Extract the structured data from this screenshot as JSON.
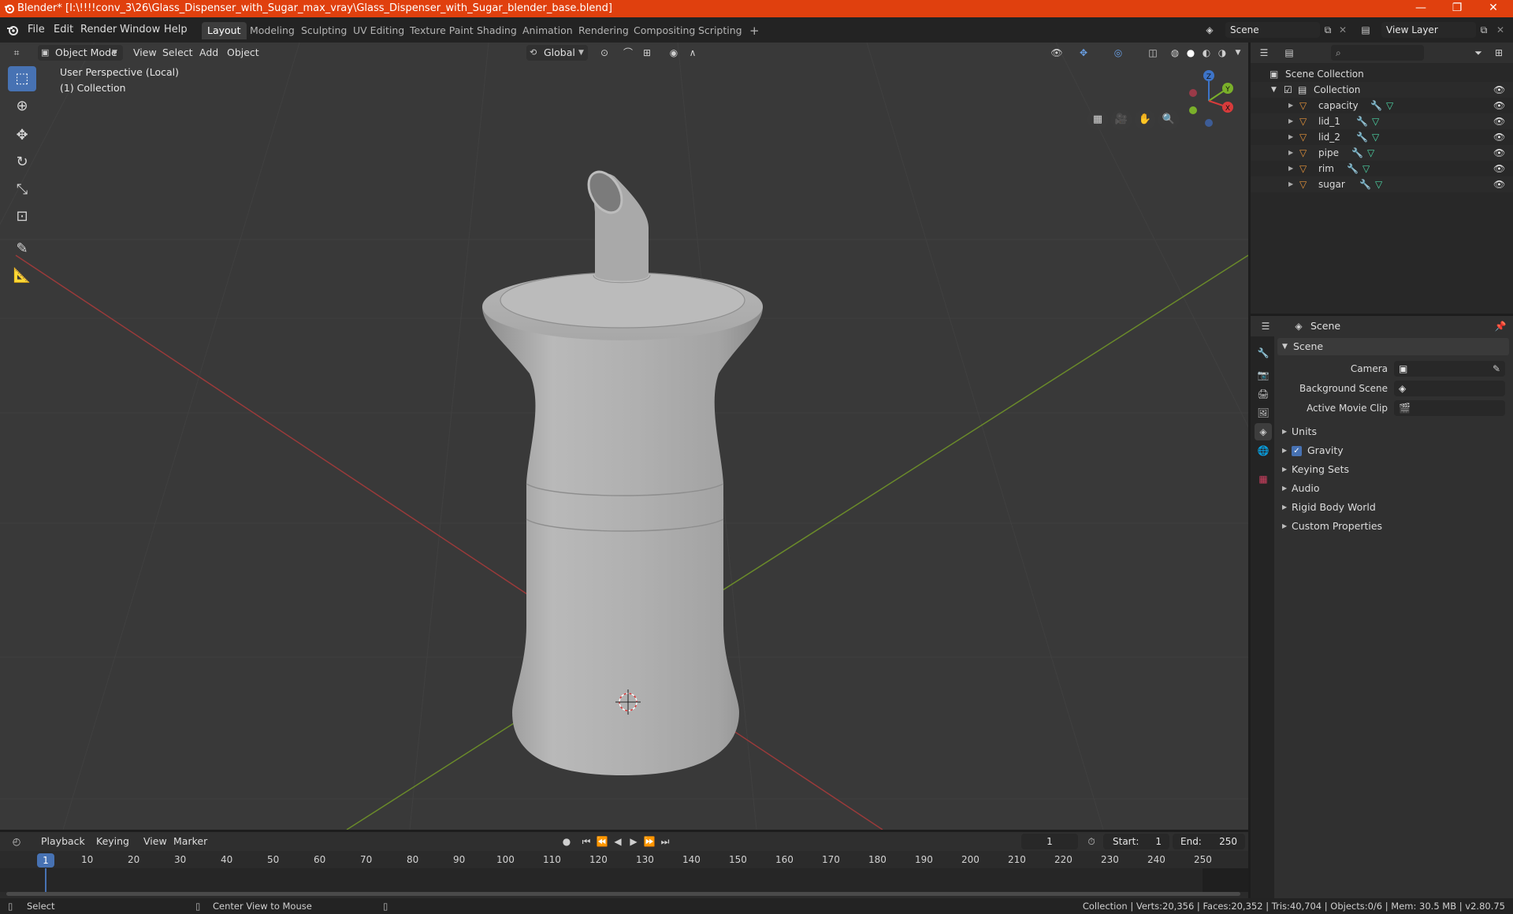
{
  "window": {
    "title": "Blender* [I:\\!!!!conv_3\\26\\Glass_Dispenser_with_Sugar_max_vray\\Glass_Dispenser_with_Sugar_blender_base.blend]",
    "minimize": "—",
    "restore": "❐",
    "close": "✕",
    "accent": "#e0400e"
  },
  "menu": {
    "items": [
      "File",
      "Edit",
      "Render",
      "Window",
      "Help"
    ]
  },
  "workspaces": {
    "tabs": [
      "Layout",
      "Modeling",
      "Sculpting",
      "UV Editing",
      "Texture Paint",
      "Shading",
      "Animation",
      "Rendering",
      "Compositing",
      "Scripting"
    ],
    "active": "Layout",
    "add": "+"
  },
  "scene_selector": {
    "value": "Scene"
  },
  "view_layer_selector": {
    "value": "View Layer"
  },
  "viewport": {
    "mode": "Object Mode",
    "menus": [
      "View",
      "Select",
      "Add",
      "Object"
    ],
    "orientation": "Global",
    "perspective_label": "User Perspective (Local)",
    "collection_label": "(1) Collection",
    "background": "#393939",
    "gizmo": {
      "z": "Z",
      "y": "Y",
      "x": "X"
    }
  },
  "outliner": {
    "root": "Scene Collection",
    "collection": "Collection",
    "objects": [
      "capacity",
      "lid_1",
      "lid_2",
      "pipe",
      "rim",
      "sugar"
    ]
  },
  "properties": {
    "context": "Scene",
    "panel_title": "Scene",
    "fields": {
      "camera": "Camera",
      "background_scene": "Background Scene",
      "active_movie_clip": "Active Movie Clip"
    },
    "panels": [
      "Units",
      "Gravity",
      "Keying Sets",
      "Audio",
      "Rigid Body World",
      "Custom Properties"
    ],
    "gravity_checked": true
  },
  "timeline": {
    "menus": [
      "Playback",
      "Keying",
      "View",
      "Marker"
    ],
    "current_frame": "1",
    "start_label": "Start:",
    "start_value": "1",
    "end_label": "End:",
    "end_value": "250",
    "ticks": [
      "10",
      "20",
      "30",
      "40",
      "50",
      "60",
      "70",
      "80",
      "90",
      "100",
      "110",
      "120",
      "130",
      "140",
      "150",
      "160",
      "170",
      "180",
      "190",
      "200",
      "210",
      "220",
      "230",
      "240",
      "250"
    ],
    "playhead": "1"
  },
  "statusbar": {
    "left": "Select",
    "middle": "Center View to Mouse",
    "right": "Collection | Verts:20,356 | Faces:20,352 | Tris:40,704 | Objects:0/6 | Mem: 30.5 MB | v2.80.75"
  }
}
